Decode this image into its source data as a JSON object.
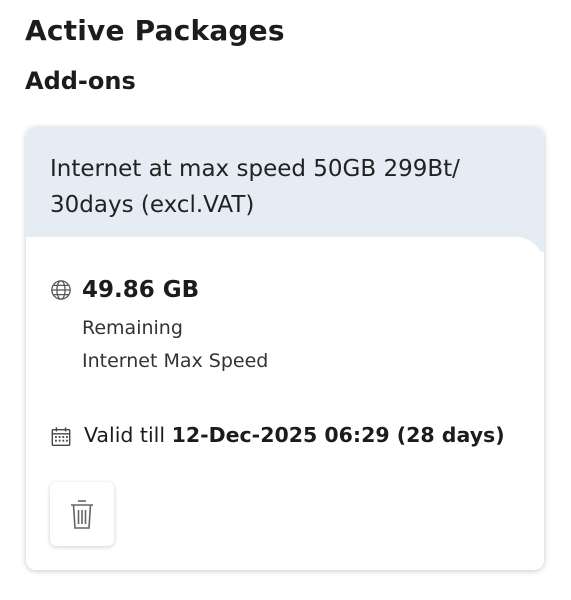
{
  "header": {
    "title": "Active Packages",
    "section": "Add-ons"
  },
  "package": {
    "name": "Internet at max speed 50GB 299Bt/ 30days (excl.VAT)",
    "data_remaining": "49.86 GB",
    "remaining_label": "Remaining",
    "speed_label": "Internet Max Speed",
    "valid_prefix": "Valid till",
    "valid_date": "12-Dec-2025 06:29 (28 days)"
  },
  "icons": {
    "data": "globe-icon",
    "validity": "calendar-icon",
    "delete": "trash-icon"
  },
  "colors": {
    "card_header_bg": "#e6ecf3",
    "text": "#1c1c1c"
  }
}
